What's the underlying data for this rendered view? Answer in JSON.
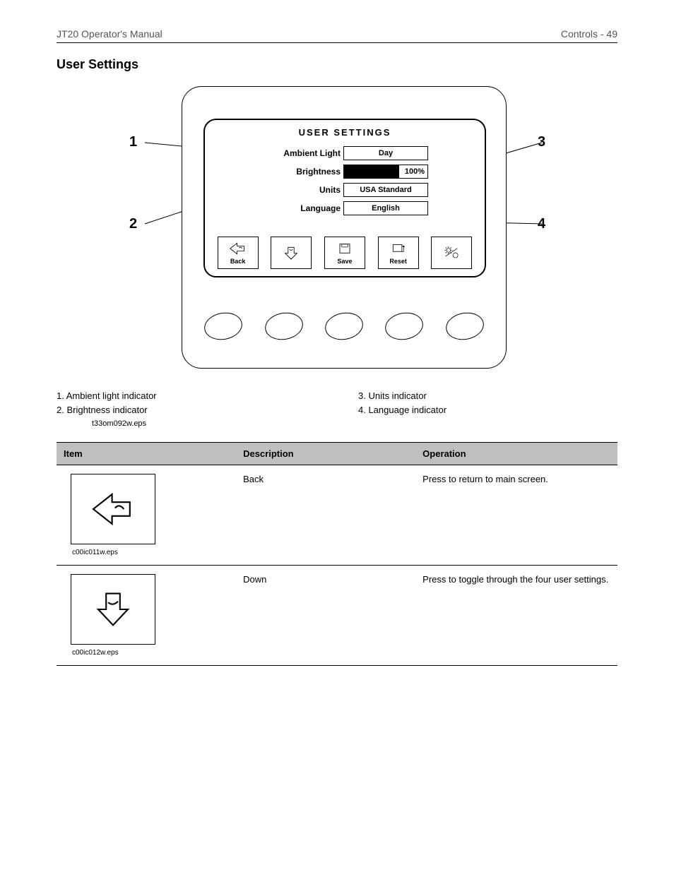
{
  "header": {
    "left": "JT20 Operator's Manual",
    "right": "Controls - 49"
  },
  "section_title": "User Settings",
  "screen": {
    "title": "USER  SETTINGS",
    "rows": [
      {
        "label": "Ambient Light",
        "value": "Day"
      },
      {
        "label": "Brightness",
        "value": "100%"
      },
      {
        "label": "Units",
        "value": "USA Standard"
      },
      {
        "label": "Language",
        "value": "English"
      }
    ],
    "softkeys": {
      "back": "Back",
      "save": "Save",
      "reset": "Reset"
    }
  },
  "callouts": {
    "c1": "1",
    "c2": "2",
    "c3": "3",
    "c4": "4"
  },
  "annotations": [
    "1. Ambient light indicator",
    "2. Brightness indicator",
    "3. Units indicator",
    "4. Language indicator"
  ],
  "figure_filename": "t33om092w.eps",
  "table": {
    "headers": {
      "item": "Item",
      "desc": "Description",
      "op": "Operation"
    },
    "rows": [
      {
        "caption": "c00ic011w.eps",
        "desc": "Back",
        "op": "Press to return to main screen."
      },
      {
        "caption": "c00ic012w.eps",
        "desc": "Down",
        "op": "Press to toggle through the four user settings."
      }
    ]
  }
}
